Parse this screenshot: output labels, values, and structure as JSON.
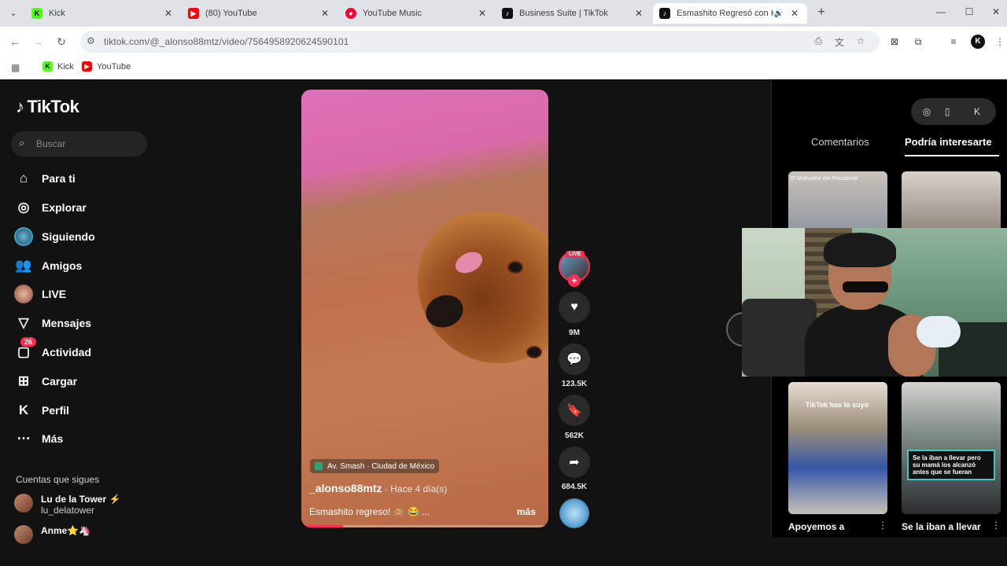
{
  "browser": {
    "tabs": [
      {
        "title": "Kick",
        "fav_color": "#53fc18",
        "fav_text": "K"
      },
      {
        "title": "(80) YouTube",
        "fav_color": "#ff0000",
        "fav_text": "▶"
      },
      {
        "title": "YouTube Music",
        "fav_color": "#ff0033",
        "fav_text": "●"
      },
      {
        "title": "Business Suite | TikTok",
        "fav_color": "#111111",
        "fav_text": "♪"
      },
      {
        "title": "Esmashito Regresó con Har",
        "fav_color": "#111111",
        "fav_text": "♪",
        "active": true
      }
    ],
    "url": "tiktok.com/@_alonso88mtz/video/7564958920624590101",
    "profile_initial": "K",
    "bookmarks": [
      {
        "label": "Kick",
        "fav_color": "#53fc18",
        "fav_text": "K"
      },
      {
        "label": "YouTube",
        "fav_color": "#ff0000",
        "fav_text": "▶"
      }
    ]
  },
  "sidebar": {
    "logo": "TikTok",
    "search_placeholder": "Buscar",
    "nav": [
      {
        "label": "Para ti",
        "icon": "home-icon"
      },
      {
        "label": "Explorar",
        "icon": "compass-icon"
      },
      {
        "label": "Siguiendo",
        "icon": "following-avatar"
      },
      {
        "label": "Amigos",
        "icon": "friends-icon"
      },
      {
        "label": "LIVE",
        "icon": "live-avatar"
      },
      {
        "label": "Mensajes",
        "icon": "send-icon"
      },
      {
        "label": "Actividad",
        "icon": "inbox-icon",
        "badge": "26"
      },
      {
        "label": "Cargar",
        "icon": "upload-icon"
      },
      {
        "label": "Perfil",
        "icon": "profile-icon"
      },
      {
        "label": "Más",
        "icon": "more-icon"
      }
    ],
    "following_heading": "Cuentas que sigues",
    "following": [
      {
        "name": "Lu de la Tower ⚡",
        "handle": "lu_delatower"
      },
      {
        "name": "Anme⭐🦄",
        "handle": ""
      }
    ]
  },
  "video": {
    "location": "Av. Smash · Ciudad de México",
    "username": "_alonso88mtz",
    "time": " · Hace 4 día(s)",
    "description": "Esmashito regreso! 🙈 😂 ...",
    "more": "más",
    "progress": 0.17
  },
  "actions": {
    "live_tag": "LIVE",
    "likes": "9M",
    "comments": "123.5K",
    "saves": "562K",
    "shares": "684.5K"
  },
  "right_panel": {
    "tab_comments": "Comentarios",
    "tab_suggested": "Podría interesarte",
    "thumbs": [
      {
        "caption": "El Motivador del Presidente",
        "title": ""
      },
      {
        "caption": "",
        "title": ""
      },
      {
        "caption": "TikTok has lo suyo",
        "title": "Apoyemos a"
      },
      {
        "caption": "Se la iban a llevar pero su mamá los alcanzó antes que se fueran",
        "title": "Se la iban a llevar"
      }
    ]
  }
}
